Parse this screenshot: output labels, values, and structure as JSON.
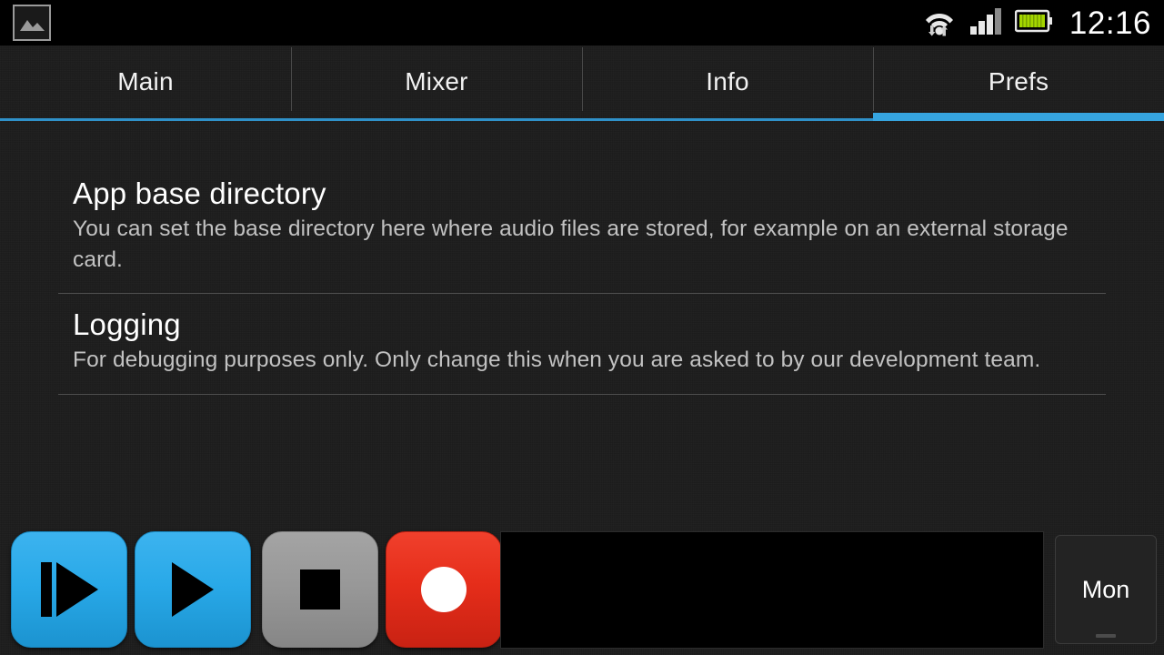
{
  "statusbar": {
    "left_icon": "photo-icon",
    "wifi_icon": "wifi-icon",
    "signal_icon": "cell-signal-icon",
    "battery_icon": "battery-icon",
    "time": "12:16"
  },
  "tabs": [
    {
      "label": "Main",
      "active": false
    },
    {
      "label": "Mixer",
      "active": false
    },
    {
      "label": "Info",
      "active": false
    },
    {
      "label": "Prefs",
      "active": true
    }
  ],
  "prefs": [
    {
      "title": "App base directory",
      "desc": "You can set the base directory here where audio files are stored, for example on an external storage card."
    },
    {
      "title": "Logging",
      "desc": "For debugging purposes only. Only change this when you are asked to by our development team."
    }
  ],
  "transport": {
    "cue_name": "play-from-start-icon",
    "play_name": "play-icon",
    "stop_name": "stop-icon",
    "record_name": "record-icon",
    "monitor_label": "Mon"
  },
  "colors": {
    "accent_blue": "#36a5e0",
    "tab_underline": "#2f91c9",
    "button_blue": "#29a9e8",
    "button_gray": "#989898",
    "button_red": "#e52d1a",
    "background": "#1c1c1c",
    "statusbar_bg": "#000000",
    "title_text": "#ffffff",
    "desc_text": "#c2c2c2",
    "battery_green": "#a4d600"
  }
}
